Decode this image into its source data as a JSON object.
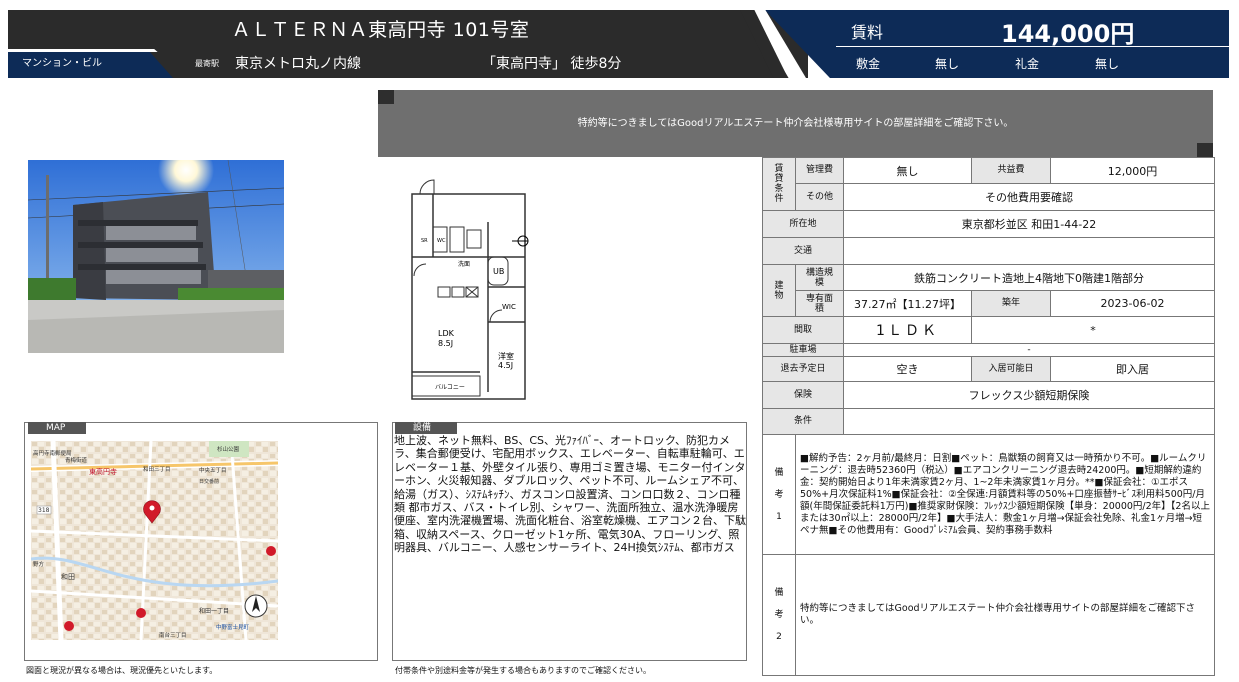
{
  "header": {
    "title": "ＡＬＴＥＲＮＡ東高円寺 101号室",
    "property_type": "マンション・ビル",
    "nearest_station_label": "最寄駅",
    "line": "東京メトロ丸ノ内線",
    "station": "「東高円寺」 徒歩8分",
    "rent_label": "賃料",
    "rent_value": "144,000円",
    "deposit_label": "敷金",
    "deposit_value": "無し",
    "key_money_label": "礼金",
    "key_money_value": "無し"
  },
  "notice": "特約等につきましてはGoodリアルエステート仲介会社様専用サイトの部屋詳細をご確認下さい。",
  "floorplan": {
    "ldk": "LDK",
    "ldk_size": "8.5J",
    "western": "洋室",
    "western_size": "4.5J",
    "washroom": "洗面",
    "ub": "UB",
    "wic": "WIC",
    "sr": "SR",
    "wc": "WC",
    "balcony": "バルコニー"
  },
  "spec": {
    "rental_terms_label": "賃貸条件",
    "mgmt_fee_label": "管理費",
    "mgmt_fee": "無し",
    "common_fee_label": "共益費",
    "common_fee": "12,000円",
    "other_label": "その他",
    "other": "その他費用要確認",
    "address_label": "所在地",
    "address": "東京都杉並区 和田1-44-22",
    "transport_label": "交通",
    "transport": "",
    "building_label": "建物",
    "structure_label": "構造規模",
    "structure": "鉄筋コンクリート造地上4階地下0階建1階部分",
    "area_label": "専有面積",
    "area": "37.27㎡【11.27坪】",
    "age_label": "築年",
    "age": "2023-06-02",
    "layout_label": "間取",
    "layout": "1ＬＤＫ",
    "layout_extra": "*",
    "parking_label": "駐車場",
    "parking": "-",
    "leave_label": "退去予定日",
    "leave": "空き",
    "move_in_label": "入居可能日",
    "move_in": "即入居",
    "insurance_label": "保険",
    "insurance": "フレックス少額短期保険",
    "conditions_label": "条件",
    "conditions": "",
    "remarks1_label": "備考1",
    "remarks1": "■解約予告：2ヶ月前/最終月：日割■ペット：鳥獣類の飼育又は一時預かり不可。■ルームクリーニング：退去時52360円（税込）■エアコンクリーニング退去時24200円。■短期解約違約金：契約開始日より1年未満家賃2ヶ月、1~2年未満家賃1ヶ月分。**■保証会社：①エポス50%+月次保証料1%■保証会社：②全保連:月額賃料等の50%+口座振替ｻｰﾋﾞｽ利用料500円/月額(年間保証委託料1万円)■推奨家財保険：ﾌﾚｯｸｽ少額短期保険【単身：20000円/2年】【2名以上または30㎡以上：28000円/2年】■大手法人：敷金1ヶ月増→保証会社免除、礼金1ヶ月増→短ペナ無■その他費用有：Goodﾌﾟﾚﾐｱﾑ会員、契約事務手数料",
    "remarks2_label": "備考2",
    "remarks2": "特約等につきましてはGoodリアルエステート仲介会社様専用サイトの部屋詳細をご確認下さい。"
  },
  "map": {
    "tag": "MAP",
    "labels": [
      "高円寺南郵便局",
      "青梅街道",
      "東高円寺",
      "和田三丁目",
      "中央五丁目",
      "杉山公園",
      "日交番前",
      "318",
      "野方",
      "和田",
      "和田一丁目",
      "中野富士見町",
      "南台三丁目"
    ],
    "footnote": "図面と現況が異なる場合は、現況優先といたします。"
  },
  "equipment": {
    "tag": "設備",
    "text": "地上波、ネット無料、BS、CS、光ﾌｧｲﾊﾞｰ、オートロック、防犯カメラ、集合郵便受け、宅配用ボックス、エレベーター、自転車駐輪可、エレベーター１基、外壁タイル張り、専用ゴミ置き場、モニター付インターホン、火災報知器、ダブルロック、ペット不可、ルームシェア不可、給湯（ガス）、ｼｽﾃﾑｷｯﾁﾝ、ガスコンロ設置済、コンロ口数２、コンロ種類 都市ガス、バス・トイレ別、シャワー、洗面所独立、温水洗浄暖房便座、室内洗濯機置場、洗面化粧台、浴室乾燥機、エアコン２台、下駄箱、収納スペース、クローゼット1ヶ所、電気30A、フローリング、照明器具、バルコニー、人感センサーライト、24H換気ｼｽﾃﾑ、都市ガス",
    "footnote": "付帯条件や別途料金等が発生する場合もありますのでご確認ください。"
  },
  "colors": {
    "header_dark": "#2b2b2b",
    "header_navy": "#0d2b57",
    "notice_gray": "#6f6f6f",
    "label_gray": "#e6e6e6",
    "map_pin": "#d11a2a"
  }
}
